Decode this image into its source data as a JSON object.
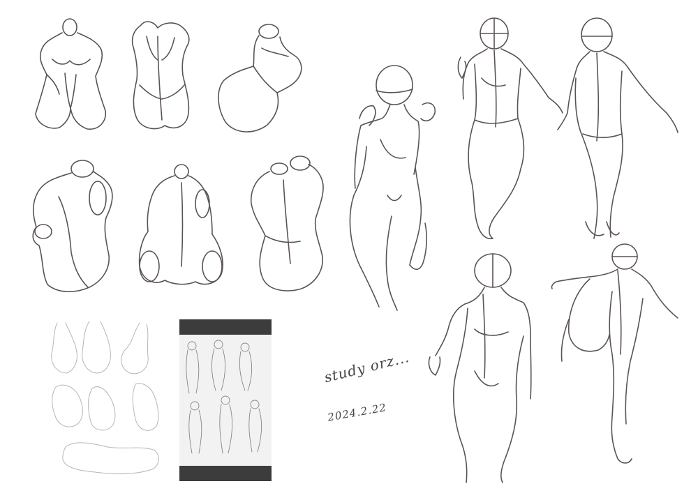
{
  "notes": {
    "study": "study orz...",
    "date": "2024.2.22"
  },
  "colors": {
    "background": "#ffffff",
    "line": "#5a5356",
    "panel_bar": "#3c3c3c"
  }
}
